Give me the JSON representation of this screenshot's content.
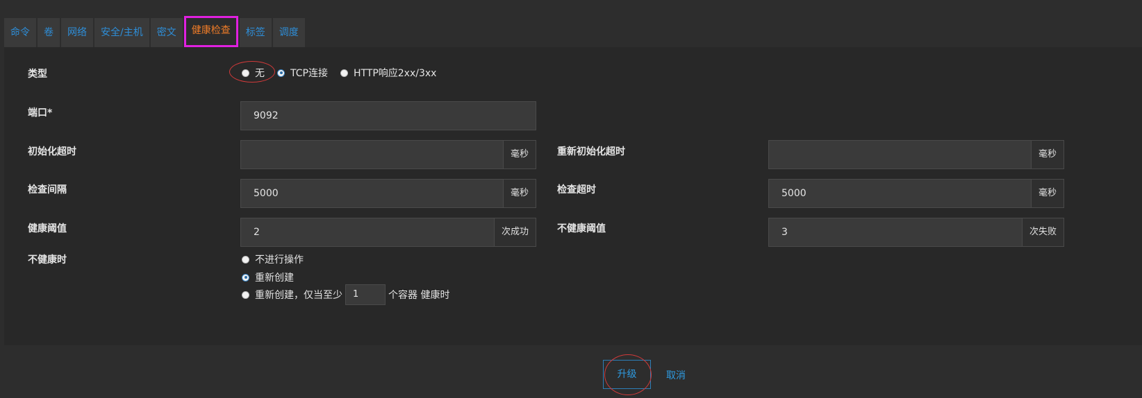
{
  "tabs": [
    {
      "label": "命令",
      "active": false
    },
    {
      "label": "卷",
      "active": false
    },
    {
      "label": "网络",
      "active": false
    },
    {
      "label": "安全/主机",
      "active": false
    },
    {
      "label": "密文",
      "active": false
    },
    {
      "label": "健康检查",
      "active": true
    },
    {
      "label": "标签",
      "active": false
    },
    {
      "label": "调度",
      "active": false
    }
  ],
  "form": {
    "type_label": "类型",
    "type_options": [
      "无",
      "TCP连接",
      "HTTP响应2xx/3xx"
    ],
    "type_selected": "TCP连接",
    "port_label": "端口*",
    "port_value": "9092",
    "init_timeout_label": "初始化超时",
    "init_timeout_value": "",
    "init_timeout_unit": "毫秒",
    "reinit_timeout_label": "重新初始化超时",
    "reinit_timeout_value": "",
    "reinit_timeout_unit": "毫秒",
    "check_interval_label": "检查间隔",
    "check_interval_value": "5000",
    "check_interval_unit": "毫秒",
    "check_timeout_label": "检查超时",
    "check_timeout_value": "5000",
    "check_timeout_unit": "毫秒",
    "healthy_threshold_label": "健康阈值",
    "healthy_threshold_value": "2",
    "healthy_threshold_unit": "次成功",
    "unhealthy_threshold_label": "不健康阈值",
    "unhealthy_threshold_value": "3",
    "unhealthy_threshold_unit": "次失败",
    "unhealthy_action_label": "不健康时",
    "unhealthy_options": {
      "none": "不进行操作",
      "recreate": "重新创建",
      "recreate_prefix": "重新创建，仅当至少",
      "recreate_count": "1",
      "recreate_suffix": "个容器 健康时"
    },
    "unhealthy_selected": "重新创建"
  },
  "footer": {
    "upgrade_label": "升级",
    "cancel_label": "取消"
  },
  "colors": {
    "accent": "#2e9ae0",
    "active_tab": "#ef7c28",
    "highlight_box": "#e020e0",
    "annotation_circle": "#d23a3a"
  }
}
